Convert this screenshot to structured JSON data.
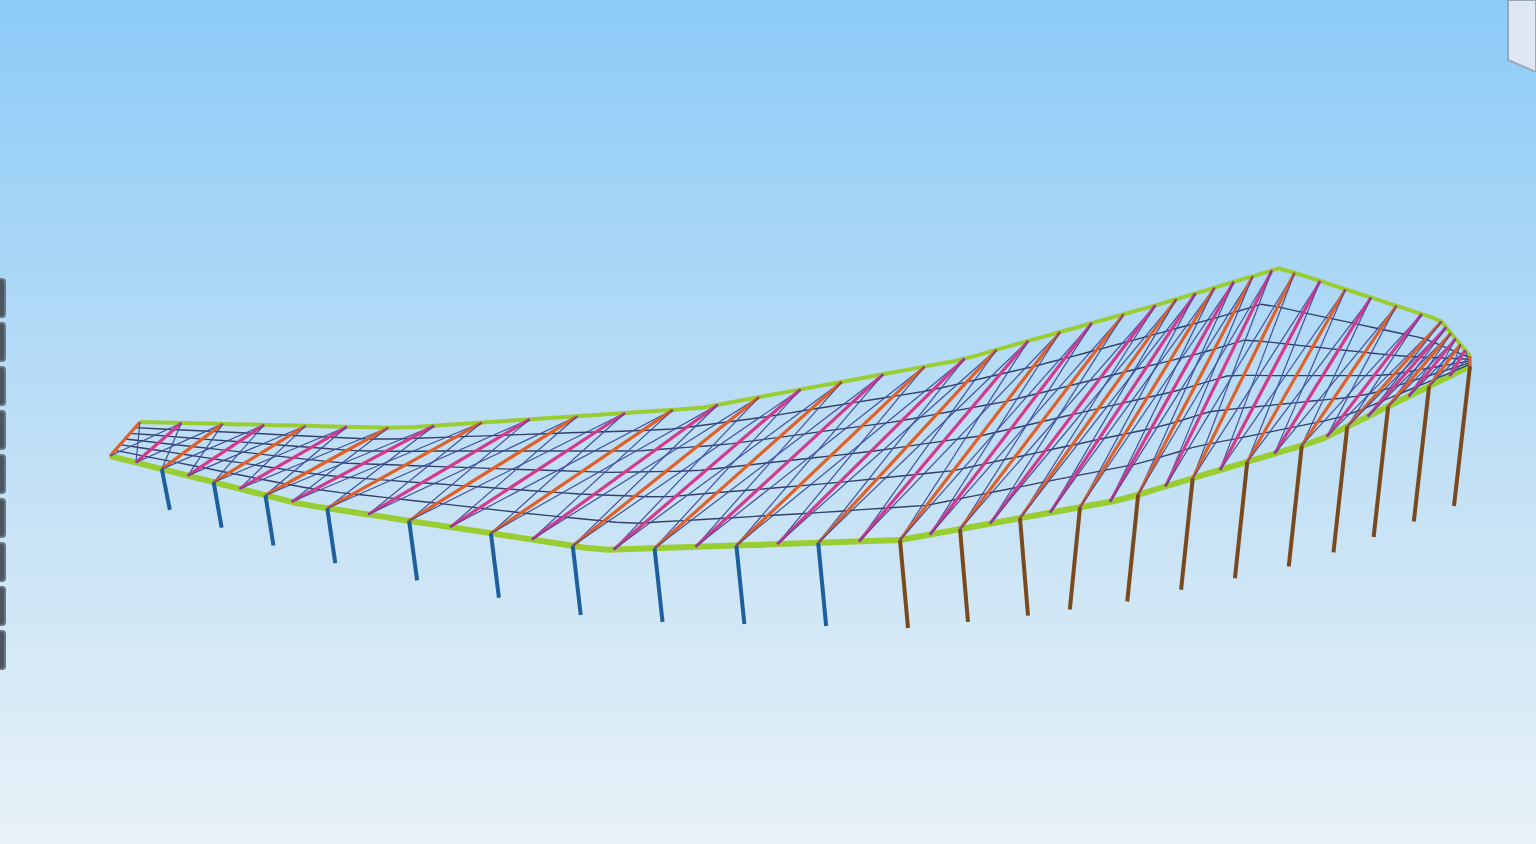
{
  "view": {
    "kind": "truss-roof"
  },
  "view_cube": {
    "kind": "cube"
  },
  "side_toolbar": [
    {
      "kind": "tool"
    },
    {
      "kind": "tool"
    },
    {
      "kind": "tool"
    },
    {
      "kind": "tool"
    },
    {
      "kind": "tool"
    },
    {
      "kind": "tool"
    },
    {
      "kind": "tool"
    },
    {
      "kind": "tool"
    },
    {
      "kind": "tool"
    }
  ]
}
